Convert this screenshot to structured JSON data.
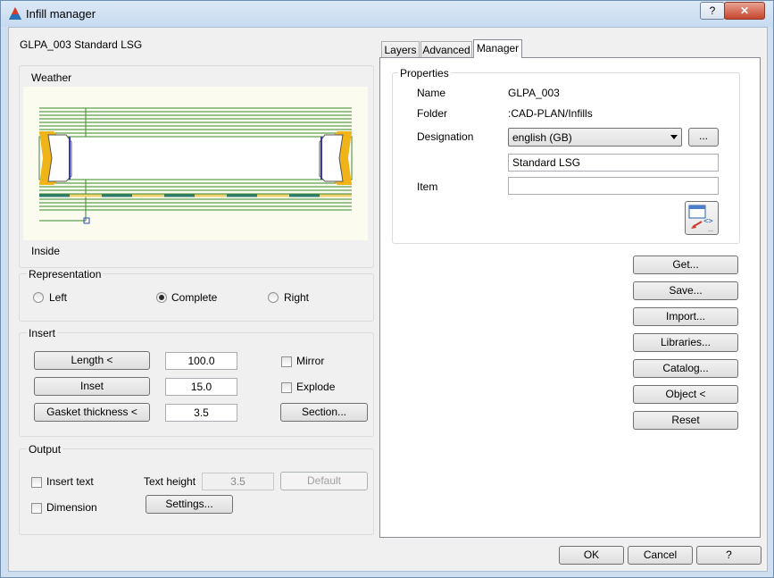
{
  "window": {
    "title": "Infill manager",
    "help_label": "?",
    "close_label": "✕"
  },
  "infill_title": "GLPA_003 Standard LSG",
  "preview": {
    "top_label": "Weather",
    "bottom_label": "Inside"
  },
  "representation": {
    "title": "Representation",
    "options": [
      {
        "label": "Left",
        "selected": false
      },
      {
        "label": "Complete",
        "selected": true
      },
      {
        "label": "Right",
        "selected": false
      }
    ]
  },
  "insert": {
    "title": "Insert",
    "length_button": "Length <",
    "length_value": "100.0",
    "inset_button": "Inset",
    "inset_value": "15.0",
    "gasket_button": "Gasket thickness <",
    "gasket_value": "3.5",
    "mirror_label": "Mirror",
    "explode_label": "Explode",
    "section_button": "Section..."
  },
  "output": {
    "title": "Output",
    "insert_text_label": "Insert text",
    "text_height_label": "Text height",
    "text_height_value": "3.5",
    "default_button": "Default",
    "dimension_label": "Dimension",
    "settings_button": "Settings..."
  },
  "tabs": [
    {
      "label": "Layers",
      "active": false
    },
    {
      "label": "Advanced",
      "active": false
    },
    {
      "label": "Manager",
      "active": true
    }
  ],
  "properties": {
    "title": "Properties",
    "name_label": "Name",
    "name_value": "GLPA_003",
    "folder_label": "Folder",
    "folder_value": ":CAD-PLAN/Infills",
    "designation_label": "Designation",
    "designation_value": "english (GB)",
    "browse_label": "...",
    "designation_text": "Standard LSG",
    "item_label": "Item",
    "item_value": ""
  },
  "actions": {
    "get": "Get...",
    "save": "Save...",
    "import": "Import...",
    "libraries": "Libraries...",
    "catalog": "Catalog...",
    "object": "Object <",
    "reset": "Reset"
  },
  "footer": {
    "ok": "OK",
    "cancel": "Cancel",
    "help": "?"
  },
  "colors": {
    "gasket": "#f0b419",
    "glass_lines": "#3a8a2a",
    "preview_bg": "#fbfbf0",
    "spacer": "#2f7a6e"
  }
}
